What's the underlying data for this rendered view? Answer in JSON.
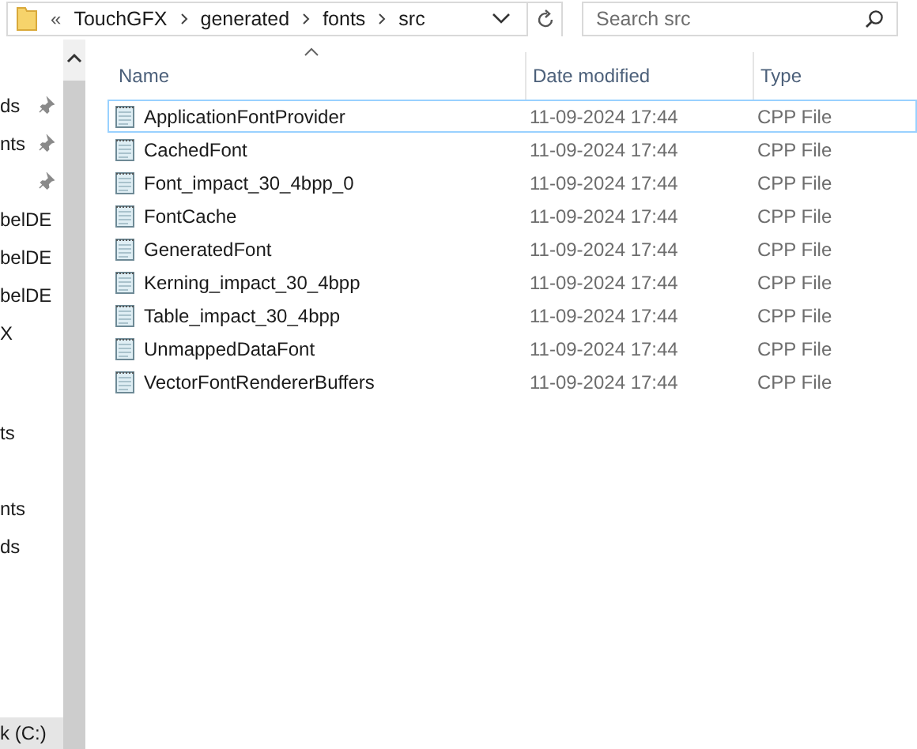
{
  "address_bar": {
    "overflow": "«",
    "crumbs": [
      "TouchGFX",
      "generated",
      "fonts",
      "src"
    ]
  },
  "search": {
    "placeholder": "Search src"
  },
  "sidebar": {
    "sections": [
      [
        {
          "label": "ds",
          "pinned": true
        },
        {
          "label": "nts",
          "pinned": true
        },
        {
          "pinned": true
        },
        {
          "label": "belDE",
          "pinned": false
        },
        {
          "label": "belDE",
          "pinned": false
        },
        {
          "label": "belDE",
          "pinned": false
        },
        {
          "label": "X",
          "pinned": false
        }
      ],
      [
        {
          "label": "ts",
          "pinned": false
        }
      ],
      [
        {
          "label": "nts",
          "pinned": false
        },
        {
          "label": "ds",
          "pinned": false
        }
      ]
    ],
    "drive": {
      "label": "k (C:)",
      "selected": true
    }
  },
  "table": {
    "columns": [
      "Name",
      "Date modified",
      "Type"
    ],
    "rows": [
      {
        "name": "ApplicationFontProvider",
        "date": "11-09-2024 17:44",
        "type": "CPP File",
        "selected": true
      },
      {
        "name": "CachedFont",
        "date": "11-09-2024 17:44",
        "type": "CPP File",
        "selected": false
      },
      {
        "name": "Font_impact_30_4bpp_0",
        "date": "11-09-2024 17:44",
        "type": "CPP File",
        "selected": false
      },
      {
        "name": "FontCache",
        "date": "11-09-2024 17:44",
        "type": "CPP File",
        "selected": false
      },
      {
        "name": "GeneratedFont",
        "date": "11-09-2024 17:44",
        "type": "CPP File",
        "selected": false
      },
      {
        "name": "Kerning_impact_30_4bpp",
        "date": "11-09-2024 17:44",
        "type": "CPP File",
        "selected": false
      },
      {
        "name": "Table_impact_30_4bpp",
        "date": "11-09-2024 17:44",
        "type": "CPP File",
        "selected": false
      },
      {
        "name": "UnmappedDataFont",
        "date": "11-09-2024 17:44",
        "type": "CPP File",
        "selected": false
      },
      {
        "name": "VectorFontRendererBuffers",
        "date": "11-09-2024 17:44",
        "type": "CPP File",
        "selected": false
      }
    ]
  }
}
